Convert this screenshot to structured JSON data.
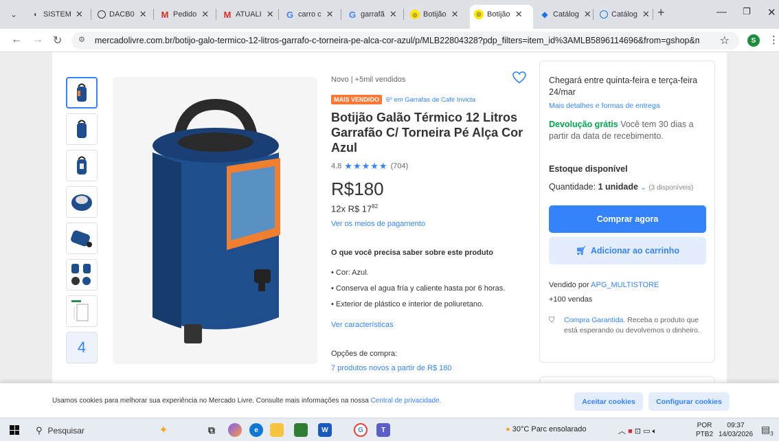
{
  "browser": {
    "tabs": [
      {
        "title": "SISTEM",
        "favicon": "E",
        "color": "#444444"
      },
      {
        "title": "DACB0",
        "favicon": "globe",
        "color": "#444444"
      },
      {
        "title": "Pedido",
        "favicon": "M",
        "color": "#d93025"
      },
      {
        "title": "ATUALI",
        "favicon": "M",
        "color": "#d93025"
      },
      {
        "title": "carro c",
        "favicon": "G",
        "color": "#4285f4"
      },
      {
        "title": "garrafã",
        "favicon": "G",
        "color": "#4285f4"
      },
      {
        "title": "Botijão",
        "favicon": "ml",
        "color": "#ffe600"
      },
      {
        "title": "Botijão",
        "favicon": "ml",
        "color": "#ffe600"
      },
      {
        "title": "Catálog",
        "favicon": "diamond",
        "color": "#1a73e8"
      },
      {
        "title": "Catálog",
        "favicon": "circle",
        "color": "#1a73e8"
      }
    ],
    "new_tab": "+",
    "url": "mercadolivre.com.br/botijo-galo-termico-12-litros-garrafo-c-torneira-pe-alca-cor-azul/p/MLB22804328?pdp_filters=item_id%3AMLB5896114696&from=gshop&matt_tool=...",
    "profile_initial": "S"
  },
  "product": {
    "condition": "Novo  |  +5mil vendidos",
    "badge": "MAIS VENDIDO",
    "badge_link": "6º em Garrafas de Café Invicta",
    "title": "Botijão Galão Térmico 12 Litros Garrafão C/ Torneira Pé Alça Cor Azul",
    "rating": "4.8",
    "stars": "★★★★★",
    "reviews": "(704)",
    "price": "R$180",
    "installments_prefix": "12x R$ 17",
    "installments_cents": "82",
    "payment_link": "Ver os meios de pagamento",
    "know_title": "O que você precisa saber sobre este produto",
    "features": [
      "• Cor: Azul.",
      "• Conserva el agua fría y caliente hasta por 6 horas.",
      "• Exterior de plástico e interior de poliuretano."
    ],
    "features_link": "Ver características",
    "options_label": "Opções de compra:",
    "options_link": "7 produtos novos a partir de R$ 180",
    "more_images": "4"
  },
  "sidebar": {
    "delivery": "Chegará entre quinta-feira e terça-feira 24/mar",
    "delivery_link": "Mais detalhes e formas de entrega",
    "return_free": "Devolução grátis",
    "return_text": " Você tem 30 dias a partir da data de recebimento.",
    "stock": "Estoque disponível",
    "qty_label": "Quantidade: ",
    "qty_value": "1 unidade",
    "qty_available": "(3 disponíveis)",
    "buy_button": "Comprar agora",
    "cart_button": "Adicionar ao carrinho",
    "sold_by_label": "Vendido por ",
    "seller": "APG_MULTISTORE",
    "sales": "+100 vendas",
    "guarantee_link": "Compra Garantida.",
    "guarantee_text": " Receba o produto que está esperando ou devolvemos o dinheiro."
  },
  "cookies": {
    "text": "Usamos cookies para melhorar sua experiência no Mercado Livre. Consulte mais informações na nossa ",
    "link": "Central de privacidade.",
    "accept": "Aceitar cookies",
    "configure": "Configurar cookies"
  },
  "taskbar": {
    "search_placeholder": "Pesquisar",
    "weather": "30°C  Parc ensolarado",
    "lang_top": "POR",
    "lang_bottom": "PTB2",
    "time": "09:37",
    "date": "14/03/2026",
    "notifications": "3"
  },
  "colors": {
    "accent": "#3483fa",
    "badge": "#ff7733",
    "green": "#00a650"
  }
}
